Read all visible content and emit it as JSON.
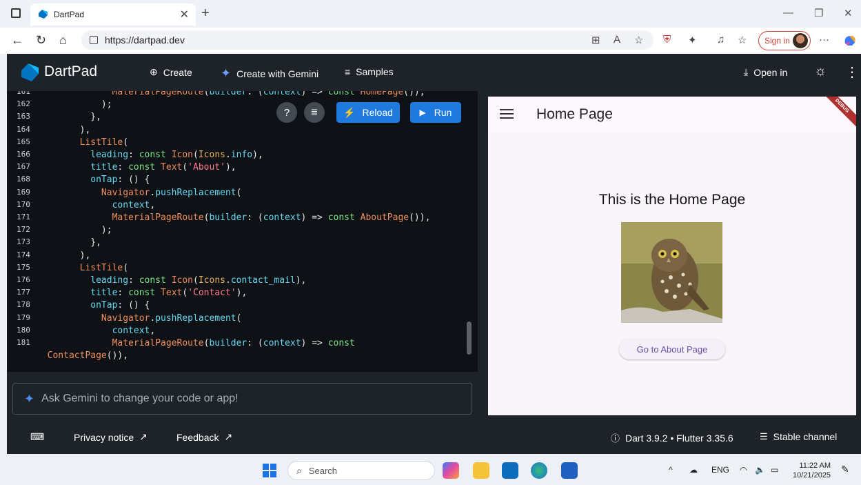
{
  "browser": {
    "tab_title": "DartPad",
    "url": "https://dartpad.dev",
    "signin_label": "Sign in"
  },
  "header": {
    "brand": "DartPad",
    "create_label": "Create",
    "create_gemini_label": "Create with Gemini",
    "samples_label": "Samples",
    "open_in_label": "Open in"
  },
  "editor": {
    "reload_label": "Reload",
    "run_label": "Run",
    "gemini_placeholder": "Ask Gemini to change your code or app!",
    "lines": [
      {
        "n": "161",
        "code": "              MaterialPageRoute(builder: (context) => const HomePage()),"
      },
      {
        "n": "162",
        "code": "            );"
      },
      {
        "n": "163",
        "code": "          },"
      },
      {
        "n": "164",
        "code": "        ),"
      },
      {
        "n": "165",
        "code": "        ListTile("
      },
      {
        "n": "166",
        "code": "          leading: const Icon(Icons.info),"
      },
      {
        "n": "167",
        "code": "          title: const Text('About'),"
      },
      {
        "n": "168",
        "code": "          onTap: () {"
      },
      {
        "n": "169",
        "code": "            Navigator.pushReplacement("
      },
      {
        "n": "170",
        "code": "              context,"
      },
      {
        "n": "171",
        "code": "              MaterialPageRoute(builder: (context) => const AboutPage()),"
      },
      {
        "n": "172",
        "code": "            );"
      },
      {
        "n": "173",
        "code": "          },"
      },
      {
        "n": "174",
        "code": "        ),"
      },
      {
        "n": "175",
        "code": "        ListTile("
      },
      {
        "n": "176",
        "code": "          leading: const Icon(Icons.contact_mail),"
      },
      {
        "n": "177",
        "code": "          title: const Text('Contact'),"
      },
      {
        "n": "178",
        "code": "          onTap: () {"
      },
      {
        "n": "179",
        "code": "            Navigator.pushReplacement("
      },
      {
        "n": "180",
        "code": "              context,"
      },
      {
        "n": "181",
        "code": "              MaterialPageRoute(builder: (context) => const"
      },
      {
        "n": "",
        "code": "  ContactPage()),"
      }
    ]
  },
  "preview": {
    "appbar_title": "Home Page",
    "heading": "This is the Home Page",
    "button_label": "Go to About Page",
    "debug_banner": "DEBUG"
  },
  "footer": {
    "privacy_label": "Privacy notice",
    "feedback_label": "Feedback",
    "version_label": "Dart 3.9.2 • Flutter 3.35.6",
    "channel_label": "Stable channel"
  },
  "taskbar": {
    "search_placeholder": "Search",
    "language": "ENG",
    "time": "11:22 AM",
    "date": "10/21/2025"
  },
  "colors": {
    "accent": "#1f7ae0",
    "editor_bg": "#0e1116",
    "app_bg": "#1e2329"
  }
}
